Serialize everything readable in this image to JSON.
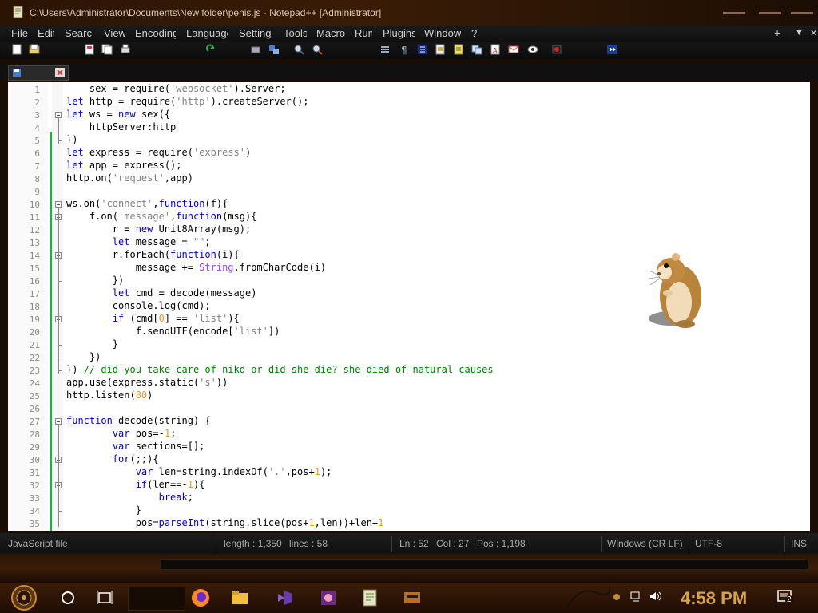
{
  "window": {
    "title": "C:\\Users\\Administrator\\Documents\\New folder\\penis.js - Notepad++ [Administrator]"
  },
  "menu": {
    "items": [
      "File",
      "Edit",
      "Search",
      "View",
      "Encoding",
      "Language",
      "Settings",
      "Tools",
      "Macro",
      "Run",
      "Plugins",
      "Window",
      "?"
    ],
    "add_tab": "+",
    "dropdown": "▼",
    "close": "✕"
  },
  "editor": {
    "line_numbers": [
      "1",
      "2",
      "3",
      "4",
      "5",
      "6",
      "7",
      "8",
      "9",
      "10",
      "11",
      "12",
      "13",
      "14",
      "15",
      "16",
      "17",
      "18",
      "19",
      "20",
      "21",
      "22",
      "23",
      "24",
      "25",
      "26",
      "27",
      "28",
      "29",
      "30",
      "31",
      "32",
      "33",
      "34",
      "35"
    ],
    "lines": [
      [
        [
          "t",
          "    sex = require("
        ],
        [
          "s",
          "'websocket'"
        ],
        [
          "t",
          ").Server;"
        ]
      ],
      [
        [
          "k",
          "let"
        ],
        [
          "t",
          " http = require("
        ],
        [
          "s",
          "'http'"
        ],
        [
          "t",
          ").createServer();"
        ]
      ],
      [
        [
          "k",
          "let"
        ],
        [
          "t",
          " ws = "
        ],
        [
          "k",
          "new"
        ],
        [
          "t",
          " sex({"
        ]
      ],
      [
        [
          "t",
          "    httpServer:http"
        ]
      ],
      [
        [
          "t",
          "})"
        ]
      ],
      [
        [
          "k",
          "let"
        ],
        [
          "t",
          " express = require("
        ],
        [
          "s",
          "'express'"
        ],
        [
          "t",
          ")"
        ]
      ],
      [
        [
          "k",
          "let"
        ],
        [
          "t",
          " app = express();"
        ]
      ],
      [
        [
          "t",
          "http.on("
        ],
        [
          "s",
          "'request'"
        ],
        [
          "t",
          ",app)"
        ]
      ],
      [
        [
          "t",
          ""
        ]
      ],
      [
        [
          "t",
          "ws.on("
        ],
        [
          "s",
          "'connect'"
        ],
        [
          "t",
          ","
        ],
        [
          "k",
          "function"
        ],
        [
          "t",
          "(f){"
        ]
      ],
      [
        [
          "t",
          "    f.on("
        ],
        [
          "s",
          "'message'"
        ],
        [
          "t",
          ","
        ],
        [
          "k",
          "function"
        ],
        [
          "t",
          "(msg){"
        ]
      ],
      [
        [
          "t",
          "        r = "
        ],
        [
          "k",
          "new"
        ],
        [
          "t",
          " Unit8Array(msg);"
        ]
      ],
      [
        [
          "t",
          "        "
        ],
        [
          "k",
          "let"
        ],
        [
          "t",
          " message = "
        ],
        [
          "s",
          "\"\""
        ],
        [
          "t",
          ";"
        ]
      ],
      [
        [
          "t",
          "        r.forEach("
        ],
        [
          "k",
          "function"
        ],
        [
          "t",
          "(i){"
        ]
      ],
      [
        [
          "t",
          "            message += "
        ],
        [
          "o",
          "String"
        ],
        [
          "t",
          ".fromCharCode(i)"
        ]
      ],
      [
        [
          "t",
          "        })"
        ]
      ],
      [
        [
          "t",
          "        "
        ],
        [
          "k",
          "let"
        ],
        [
          "t",
          " cmd = decode(message)"
        ]
      ],
      [
        [
          "t",
          "        console.log(cmd);"
        ]
      ],
      [
        [
          "t",
          "        "
        ],
        [
          "k",
          "if"
        ],
        [
          "t",
          " (cmd["
        ],
        [
          "n",
          "0"
        ],
        [
          "t",
          "] == "
        ],
        [
          "s",
          "'list'"
        ],
        [
          "t",
          "){"
        ]
      ],
      [
        [
          "t",
          "            f.sendUTF(encode["
        ],
        [
          "s",
          "'list'"
        ],
        [
          "t",
          "])"
        ]
      ],
      [
        [
          "t",
          "        }"
        ]
      ],
      [
        [
          "t",
          "    })"
        ]
      ],
      [
        [
          "t",
          "}) "
        ],
        [
          "c",
          "// did you take care of niko or did she die? she died of natural causes"
        ]
      ],
      [
        [
          "t",
          "app.use(express.static("
        ],
        [
          "s",
          "'s'"
        ],
        [
          "t",
          "))"
        ]
      ],
      [
        [
          "t",
          "http.listen("
        ],
        [
          "n",
          "80"
        ],
        [
          "t",
          ")"
        ]
      ],
      [
        [
          "t",
          ""
        ]
      ],
      [
        [
          "k",
          "function"
        ],
        [
          "t",
          " decode(string) {"
        ]
      ],
      [
        [
          "t",
          "        "
        ],
        [
          "k",
          "var"
        ],
        [
          "t",
          " pos=-"
        ],
        [
          "n",
          "1"
        ],
        [
          "t",
          ";"
        ]
      ],
      [
        [
          "t",
          "        "
        ],
        [
          "k",
          "var"
        ],
        [
          "t",
          " sections=[];"
        ]
      ],
      [
        [
          "t",
          "        "
        ],
        [
          "k",
          "for"
        ],
        [
          "t",
          "(;;){"
        ]
      ],
      [
        [
          "t",
          "            "
        ],
        [
          "k",
          "var"
        ],
        [
          "t",
          " len=string.indexOf("
        ],
        [
          "s",
          "'.'"
        ],
        [
          "t",
          ",pos+"
        ],
        [
          "n",
          "1"
        ],
        [
          "t",
          ");"
        ]
      ],
      [
        [
          "t",
          "            "
        ],
        [
          "k",
          "if"
        ],
        [
          "t",
          "(len==-"
        ],
        [
          "n",
          "1"
        ],
        [
          "t",
          "){"
        ]
      ],
      [
        [
          "t",
          "                "
        ],
        [
          "k",
          "break"
        ],
        [
          "t",
          ";"
        ]
      ],
      [
        [
          "t",
          "            }"
        ]
      ],
      [
        [
          "t",
          "            pos="
        ],
        [
          "k",
          "parseInt"
        ],
        [
          "t",
          "(string.slice(pos+"
        ],
        [
          "n",
          "1"
        ],
        [
          "t",
          ",len))+len+"
        ],
        [
          "n",
          "1"
        ]
      ]
    ]
  },
  "status": {
    "file_type": "JavaScript file",
    "length": "length : 1,350",
    "lines": "lines : 58",
    "ln": "Ln : 52",
    "col": "Col : 27",
    "pos": "Pos : 1,198",
    "eol": "Windows (CR LF)",
    "encoding": "UTF-8",
    "mode": "INS"
  },
  "taskbar": {
    "clock": "4:58 PM",
    "notification_count": "2",
    "icons": [
      "start-icon",
      "cortana-icon",
      "task-view-icon",
      "search-box",
      "firefox-icon",
      "folder-icon",
      "visual-studio-icon",
      "game-icon",
      "notepadpp-icon",
      "calculator-icon"
    ]
  },
  "colors": {
    "keyword": "#0000cc",
    "string": "#808080",
    "number": "#e69a2e",
    "comment": "#008000",
    "clock": "#d6a24a"
  }
}
